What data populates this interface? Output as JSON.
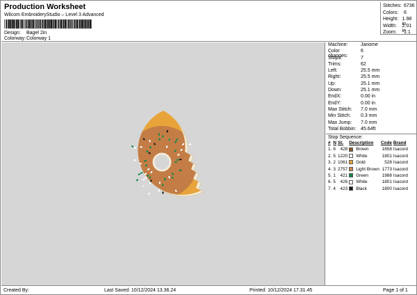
{
  "header": {
    "title": "Production Worksheet",
    "subtitle": "Wilcom EmbroideryStudio – Level 3 Advanced",
    "design_label": "Design:",
    "design_value": "Bagel 2in",
    "colorway_label": "Colorway:",
    "colorway_value": "Colorway 1"
  },
  "stats": [
    {
      "label": "Stitches:",
      "value": "6736"
    },
    {
      "label": "Colors:",
      "value": "6"
    },
    {
      "label": "Height:",
      "value": "1.98 in"
    },
    {
      "label": "Width:",
      "value": "2.01 in"
    },
    {
      "label": "Zoom:",
      "value": "1:1"
    }
  ],
  "machine_info": [
    {
      "label": "Machine:",
      "value": "Janome"
    },
    {
      "label": "Color changes:",
      "value": "6"
    },
    {
      "label": "Stops:",
      "value": "7"
    },
    {
      "label": "Trims:",
      "value": "62"
    },
    {
      "label": "Left:",
      "value": "25.5 mm"
    },
    {
      "label": "Right:",
      "value": "25.5 mm"
    },
    {
      "label": "Up:",
      "value": "25.1 mm"
    },
    {
      "label": "Down:",
      "value": "25.1 mm"
    },
    {
      "label": "EndX:",
      "value": "0.00 in"
    },
    {
      "label": "EndY:",
      "value": "0.00 in"
    },
    {
      "label": "Max Stitch:",
      "value": "7.0 mm"
    },
    {
      "label": "Min Stitch:",
      "value": "0.3 mm"
    },
    {
      "label": "Max Jump:",
      "value": "7.0 mm"
    },
    {
      "label": "Total Bobbin:",
      "value": "45.64ft"
    }
  ],
  "stop_sequence": {
    "title": "Stop Sequence:",
    "headers": [
      "#",
      "N",
      "St.",
      "Description",
      "Code",
      "Brand"
    ],
    "rows": [
      {
        "num": "1.",
        "n": "6",
        "st": "428",
        "color": "#8a5a2b",
        "desc": "Brown",
        "code": "1658",
        "brand": "Isacord"
      },
      {
        "num": "2.",
        "n": "5",
        "st": "1220",
        "color": "#ffffff",
        "desc": "White",
        "code": "1801",
        "brand": "Isacord"
      },
      {
        "num": "3.",
        "n": "2",
        "st": "1061",
        "color": "#e8a43a",
        "desc": "Gold",
        "code": "528",
        "brand": "Isacord"
      },
      {
        "num": "4.",
        "n": "3",
        "st": "2757",
        "color": "#c98a4e",
        "desc": "Light Brown",
        "code": "1773",
        "brand": "Isacord"
      },
      {
        "num": "5.",
        "n": "1",
        "st": "421",
        "color": "#0f8a4a",
        "desc": "Green",
        "code": "1988",
        "brand": "Isacord"
      },
      {
        "num": "6.",
        "n": "5",
        "st": "426",
        "color": "#ffffff",
        "desc": "White",
        "code": "1801",
        "brand": "Isacord"
      },
      {
        "num": "7.",
        "n": "4",
        "st": "423",
        "color": "#1a1a1a",
        "desc": "Black",
        "code": "1800",
        "brand": "Isacord"
      }
    ]
  },
  "footer": {
    "created_by": "Created By:",
    "last_saved": "Last Saved: 10/12/2024 13.36.24",
    "printed": "Printed: 10/12/2024 17.31.45",
    "page": "Page 1 of 1"
  },
  "colors": {
    "canvas_bg": "#d6d6d6"
  }
}
